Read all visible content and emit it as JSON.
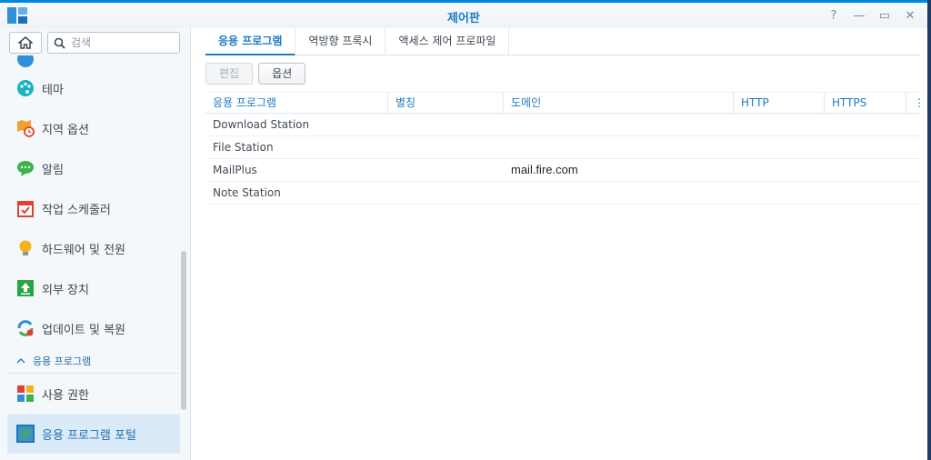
{
  "window": {
    "title": "제어판"
  },
  "sidebar": {
    "search_placeholder": "검색",
    "items": [
      {
        "label": "",
        "icon": "globe-icon",
        "partial": true
      },
      {
        "label": "테마",
        "icon": "palette-icon"
      },
      {
        "label": "지역 옵션",
        "icon": "clock-map-icon"
      },
      {
        "label": "알림",
        "icon": "chat-bubble-icon"
      },
      {
        "label": "작업 스케줄러",
        "icon": "calendar-check-icon"
      },
      {
        "label": "하드웨어 및 전원",
        "icon": "light-bulb-icon"
      },
      {
        "label": "외부 장치",
        "icon": "upload-arrow-icon"
      },
      {
        "label": "업데이트 및 복원",
        "icon": "refresh-icon"
      }
    ],
    "group": {
      "label": "응용 프로그램"
    },
    "group_items": [
      {
        "label": "사용 권한",
        "icon": "app-grid-lock-icon"
      },
      {
        "label": "응용 프로그램 포털",
        "icon": "portal-arrow-icon",
        "active": true
      }
    ]
  },
  "tabs": [
    {
      "label": "응용 프로그램",
      "active": true
    },
    {
      "label": "역방향 프록시"
    },
    {
      "label": "액세스 제어 프로파일"
    }
  ],
  "toolbar": {
    "edit_label": "편집",
    "options_label": "옵션"
  },
  "table": {
    "columns": [
      "응용 프로그램",
      "별칭",
      "도메인",
      "HTTP",
      "HTTPS",
      "⋮"
    ],
    "rows": [
      [
        "Download Station",
        "",
        "",
        "",
        ""
      ],
      [
        "File Station",
        "",
        "",
        "",
        ""
      ],
      [
        "MailPlus",
        "",
        "mail.fire.com",
        "",
        ""
      ],
      [
        "Note Station",
        "",
        "",
        "",
        ""
      ]
    ]
  },
  "colors": {
    "accent": "#1f7bc1",
    "active_bg": "#dbeaf8",
    "titlebar_border": "#0086e5"
  }
}
